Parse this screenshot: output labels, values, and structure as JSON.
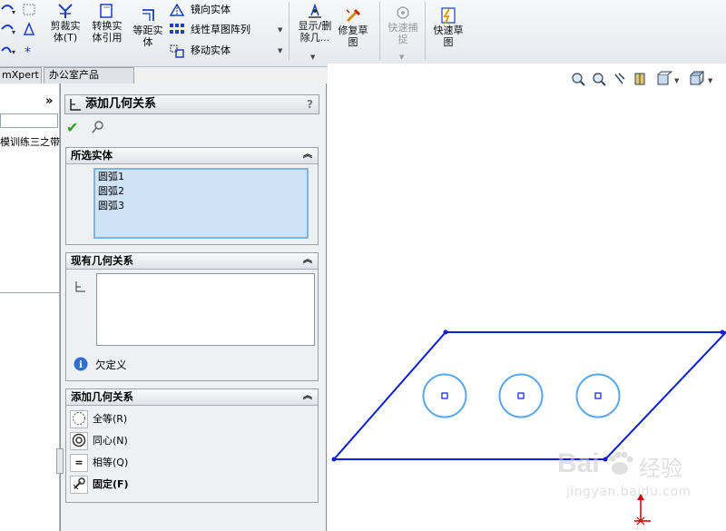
{
  "toolbar": {
    "trim_label": "剪裁实\n体(T)",
    "convert_label": "转换实\n体引用",
    "offset_label": "等距实\n体",
    "mirror_label": "镜向实体",
    "linear_pattern_label": "线性草图阵列",
    "move_label": "移动实体",
    "display_delete_label": "显示/删\n除几...",
    "repair_label": "修复草\n图",
    "quick_snap_label": "快速捕\n捉",
    "rapid_sketch_label": "快速草\n图"
  },
  "tabs": [
    "mXpert",
    "办公室产品"
  ],
  "tree": {
    "chevron": "»",
    "item_label": "模训练三之带"
  },
  "pm": {
    "title": "添加几何关系",
    "help": "?",
    "ok": "✔",
    "pin": "pin",
    "selected_group": {
      "title": "所选实体",
      "items": [
        "圆弧1",
        "圆弧2",
        "圆弧3"
      ]
    },
    "existing_group": {
      "title": "现有几何关系",
      "status": "欠定义"
    },
    "add_group": {
      "title": "添加几何关系",
      "relations": [
        {
          "label": "全等(R)",
          "icon": "coradial-icon"
        },
        {
          "label": "同心(N)",
          "icon": "concentric-icon"
        },
        {
          "label": "相等(Q)",
          "icon": "equal-icon"
        },
        {
          "label": "固定(F)",
          "icon": "fix-icon"
        }
      ]
    }
  },
  "colors": {
    "sketch_line": "#0b1fd6",
    "circle": "#5aa7ee",
    "origin": "#cc0000",
    "selected_list": "#cfe3f6"
  },
  "watermark": {
    "brand": "Bai",
    "brand_suffix": "经验",
    "url": "jingyan.baidu.com"
  }
}
